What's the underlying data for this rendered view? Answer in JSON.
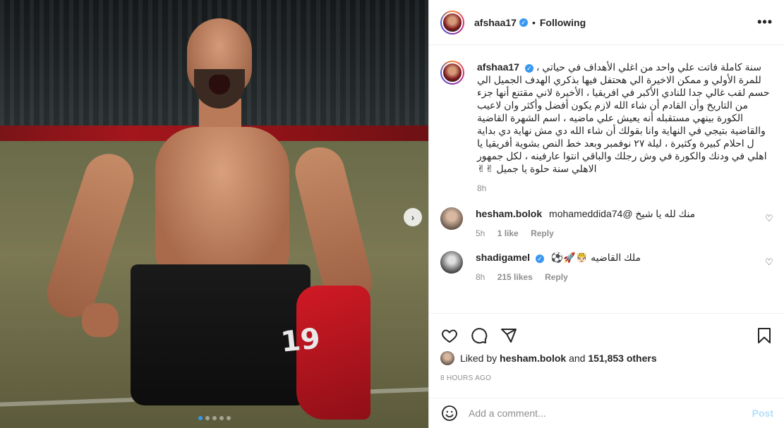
{
  "post": {
    "username": "afshaa17",
    "follow_status": "Following",
    "separator": "•",
    "more_icon": "more-horizontal-icon"
  },
  "caption": {
    "username": "afshaa17",
    "text": "سنة كاملة فاتت علي واحد من اغلي الأهداف في حياتي ، للمرة الأولي و ممكن الاخيرة الي هحتفل فيها بذكري الهدف الجميل الي حسم لقب غالي جدا للنادي الأكبر في افريقيا ، الأخيرة لاني مقتنع أنها جزء من التاريخ وأن القادم أن شاء الله لازم يكون أفضل وأكثر وان لاعيب الكورة بينهي مستقبله أنه يعيش علي ماضيه ، اسم الشهرة القاضية والقاضية بتيجي في النهاية وانا بقولك أن شاء الله دي مش نهاية دي بداية ل احلام كبيرة وكثيرة ، ليلة ٢٧ نوفمبر وبعد خط النص بشوية أفريقيا يا اهلي في ودنك والكورة في وش رجلك والباقي انتوا عارفينه ، لكل جمهور الاهلي سنة حلوة يا جميل ✌✌",
    "time": "8h"
  },
  "comments": [
    {
      "username": "hesham.bolok",
      "text": "منك لله يا شيخ @mohameddida74",
      "time": "5h",
      "likes": "1 like",
      "reply": "Reply"
    },
    {
      "username": "shadigamel",
      "text": "ملك القاضيه 🤴🏻🚀⚽",
      "time": "8h",
      "likes": "215 likes",
      "reply": "Reply"
    }
  ],
  "actions": {
    "like_icon": "heart-icon",
    "comment_icon": "comment-icon",
    "share_icon": "share-icon",
    "save_icon": "bookmark-icon"
  },
  "likes": {
    "prefix": "Liked by",
    "user": "hesham.bolok",
    "and": "and",
    "others": "151,853 others"
  },
  "timestamp": "8 HOURS AGO",
  "add_comment": {
    "placeholder": "Add a comment...",
    "post_label": "Post",
    "emoji_icon": "emoji-icon"
  },
  "photo": {
    "shorts_number": "19",
    "next_icon": "chevron-right-icon",
    "slide_count": 5,
    "active_slide": 1
  },
  "colors": {
    "accent": "#3897f0",
    "post_disabled": "#b2dffc",
    "secondary_text": "#8e8e8e"
  }
}
